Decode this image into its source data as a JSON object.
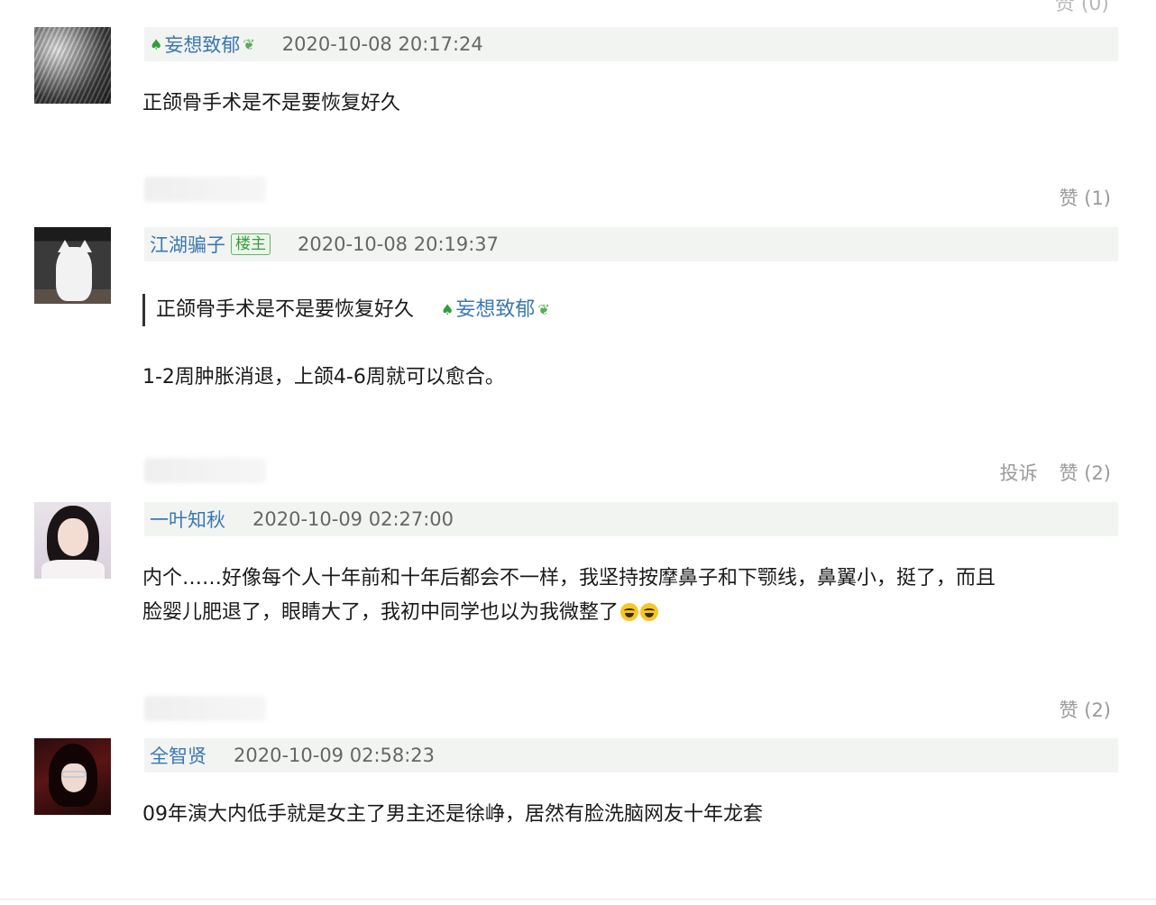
{
  "top_fragment": {
    "like_text": "赞 (0)"
  },
  "comments": [
    {
      "username": "妄想致郁",
      "timestamp": "2020-10-08 20:17:24",
      "text": "正颌骨手术是不是要恢复好久",
      "like_label": "赞 (1)"
    },
    {
      "username": "江湖骗子",
      "badge": "楼主",
      "timestamp": "2020-10-08 20:19:37",
      "quote_text": "正颌骨手术是不是要恢复好久",
      "quote_user": "妄想致郁",
      "text": "1-2周肿胀消退，上颌4-6周就可以愈合。",
      "report_label": "投诉",
      "like_label": "赞 (2)"
    },
    {
      "username": "一叶知秋",
      "timestamp": "2020-10-09 02:27:00",
      "text_line1": "内个……好像每个人十年前和十年后都会不一样，我坚持按摩鼻子和下颚线，鼻翼小，挺了，而且",
      "text_line2": "脸婴儿肥退了，眼睛大了，我初中同学也以为我微整了",
      "like_label": "赞 (2)"
    },
    {
      "username": "全智贤",
      "timestamp": "2020-10-09 02:58:23",
      "text": "09年演大内低手就是女主了男主还是徐峥，居然有脸洗脑网友十年龙套"
    }
  ],
  "icons": {
    "vip_tree": "tree-icon",
    "vip_leaf": "leaf-icon",
    "emoji": "grin-emoji"
  },
  "colors": {
    "username": "#3b78b2",
    "meta_bg": "#f2f4f2",
    "badge_green": "#3a9a40",
    "action_gray": "#9a9a9a"
  }
}
